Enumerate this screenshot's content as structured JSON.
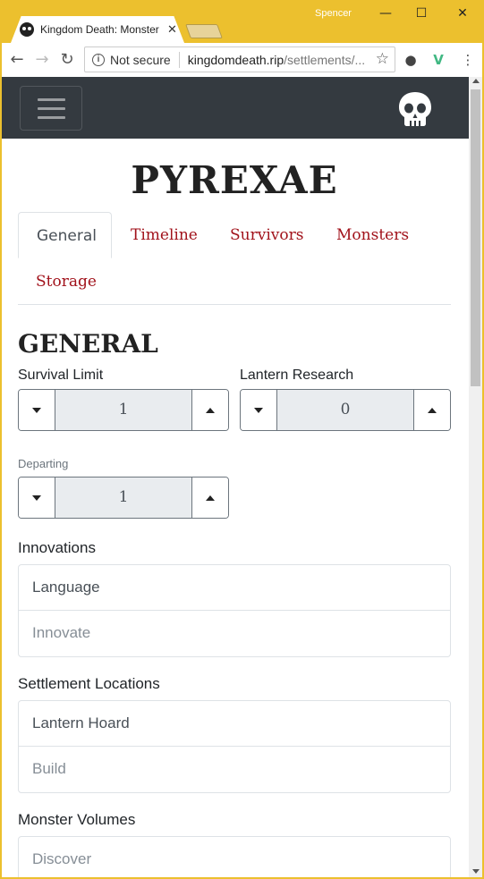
{
  "browser": {
    "user": "Spencer",
    "tab_title": "Kingdom Death: Monster",
    "security_label": "Not secure",
    "url_host": "kingdomdeath.rip",
    "url_path": "/settlements/..."
  },
  "page": {
    "title": "PYREXAE",
    "tabs": [
      {
        "label": "General",
        "active": true
      },
      {
        "label": "Timeline",
        "active": false
      },
      {
        "label": "Survivors",
        "active": false
      },
      {
        "label": "Monsters",
        "active": false
      },
      {
        "label": "Storage",
        "active": false
      }
    ],
    "general": {
      "heading": "GENERAL",
      "survival_limit": {
        "label": "Survival Limit",
        "value": "1"
      },
      "lantern_research": {
        "label": "Lantern Research",
        "value": "0"
      },
      "departing": {
        "label": "Departing",
        "value": "1"
      },
      "innovations": {
        "label": "Innovations",
        "items": [
          "Language"
        ],
        "add_placeholder": "Innovate"
      },
      "settlement_locations": {
        "label": "Settlement Locations",
        "items": [
          "Lantern Hoard"
        ],
        "add_placeholder": "Build"
      },
      "monster_volumes": {
        "label": "Monster Volumes",
        "add_placeholder": "Discover"
      }
    }
  }
}
